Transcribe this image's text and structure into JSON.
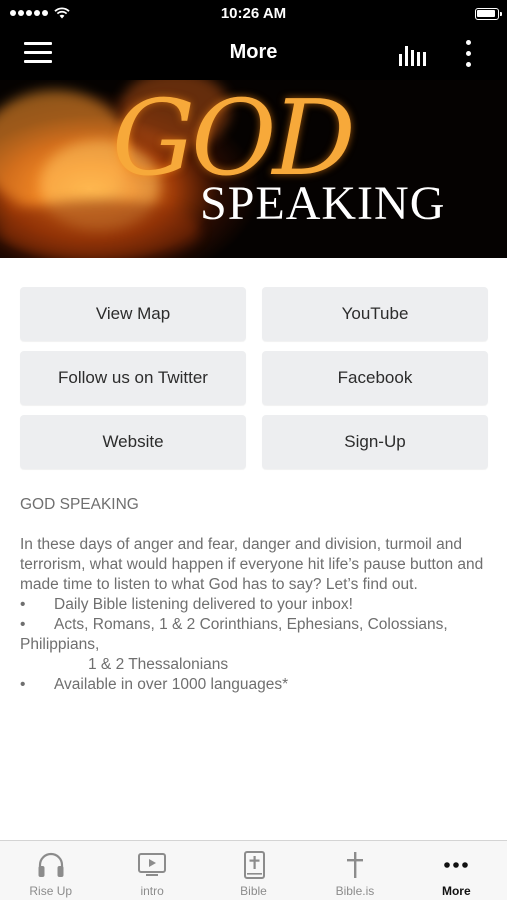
{
  "status": {
    "time": "10:26 AM"
  },
  "nav": {
    "title": "More"
  },
  "banner": {
    "word1": "GOD",
    "word2": "SPEAKING"
  },
  "buttons": [
    {
      "label": "View Map"
    },
    {
      "label": "YouTube"
    },
    {
      "label": "Follow us on Twitter"
    },
    {
      "label": "Facebook"
    },
    {
      "label": "Website"
    },
    {
      "label": "Sign-Up"
    }
  ],
  "description": {
    "title": "GOD SPEAKING",
    "paragraph": "In these days of anger and fear, danger and division, turmoil and terrorism, what would happen if everyone hit life’s pause button and made time to listen to what God has to say? Let’s find out.",
    "bullet_mark": "•",
    "bullet1": "Daily Bible listening delivered to your inbox!",
    "bullet2": "Acts, Romans, 1 & 2 Corinthians, Ephesians, Colossians, Philippians,",
    "bullet2_cont": "1 & 2 Thessalonians",
    "bullet3": "Available in over 1000 languages*"
  },
  "tabs": [
    {
      "label": "Rise Up",
      "icon": "headphones-icon"
    },
    {
      "label": "intro",
      "icon": "video-icon"
    },
    {
      "label": "Bible",
      "icon": "bible-icon"
    },
    {
      "label": "Bible.is",
      "icon": "cross-icon"
    },
    {
      "label": "More",
      "icon": "more-dots-icon"
    }
  ],
  "colors": {
    "bar": "#000000",
    "button_bg": "#edeef0",
    "text_muted": "#6f6f6f",
    "tab_active": "#111111",
    "tab_inactive": "#8c8c8c"
  }
}
